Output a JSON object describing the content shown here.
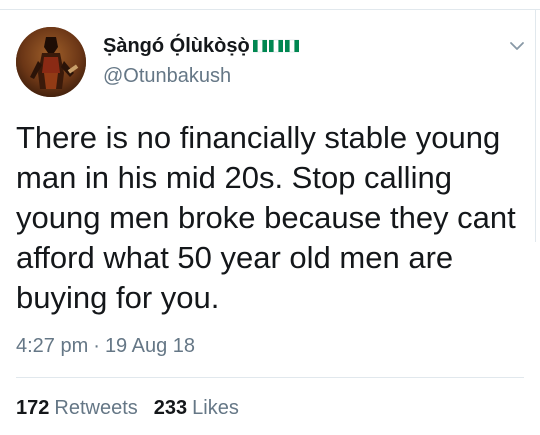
{
  "tweet": {
    "author": {
      "display_name": "Ṣàngó Ọ́lùkòṣọ̀",
      "handle": "@Otunbakush",
      "avatar_icon": "profile-photo",
      "flag_icons": [
        "nigeria-flag-icon",
        "nigeria-flag-icon",
        "nigeria-flag-icon"
      ]
    },
    "text": "There is no financially stable young man in his mid 20s. Stop calling young men broke because they cant afford what 50 year old men are buying for you.",
    "time": "4:27 pm",
    "separator": "·",
    "date": "19 Aug 18",
    "retweets": {
      "count": "172",
      "label": "Retweets"
    },
    "likes": {
      "count": "233",
      "label": "Likes"
    },
    "menu_icon": "chevron-down-icon"
  },
  "colors": {
    "text_primary": "#14171a",
    "text_secondary": "#657786",
    "divider": "#e1e8ed",
    "flag_green": "#008751"
  }
}
